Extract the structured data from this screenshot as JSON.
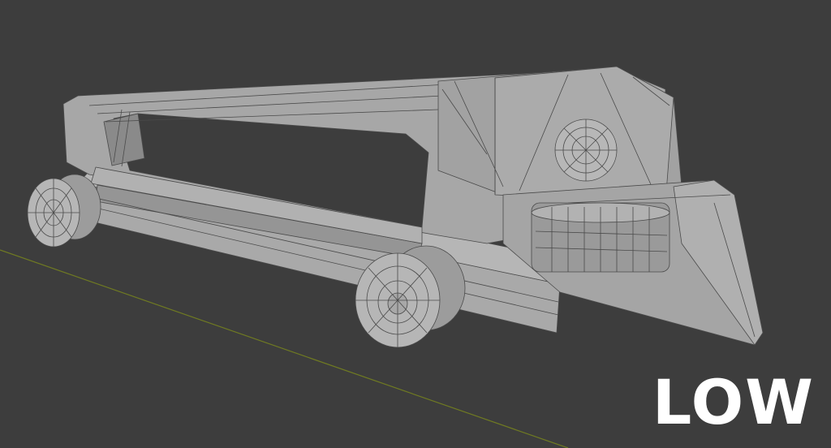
{
  "viewport": {
    "background": "#3d3d3d",
    "axis_color": "#6f7a22",
    "mesh_fill": "#9e9e9e",
    "mesh_light": "#b4b4b4",
    "mesh_dark": "#7e7e7e",
    "wire_color": "#4a4a4a"
  },
  "overlay": {
    "label": "LOW",
    "label_color": "#ffffff"
  }
}
